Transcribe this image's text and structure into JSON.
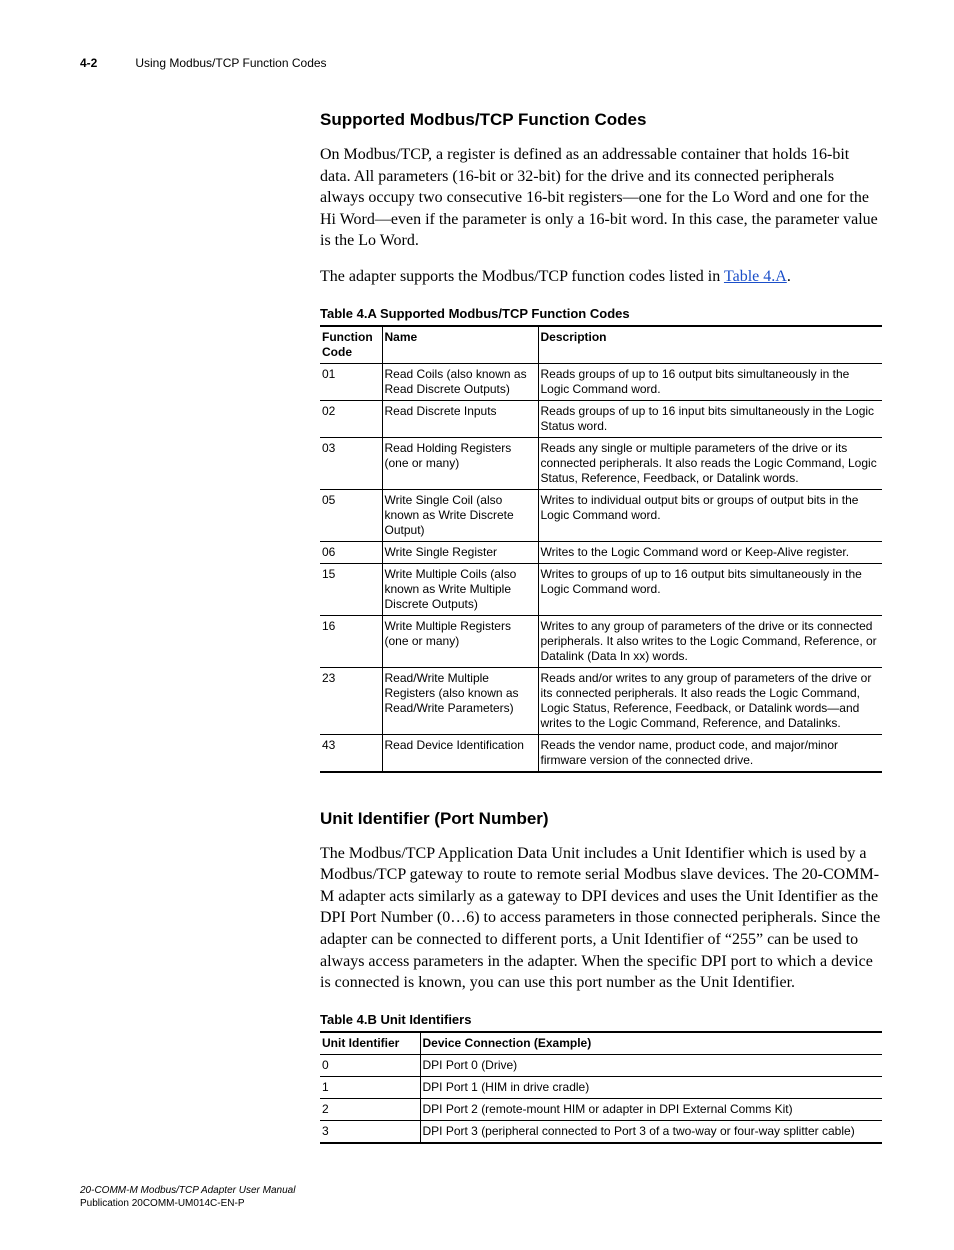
{
  "header": {
    "pageno": "4-2",
    "chapter": "Using Modbus/TCP Function Codes"
  },
  "section1": {
    "heading": "Supported Modbus/TCP Function Codes",
    "p1": "On Modbus/TCP, a register is defined as an addressable container that holds 16-bit data. All parameters (16-bit or 32-bit) for the drive and its connected peripherals always occupy two consecutive 16-bit registers—one for the Lo Word and one for the Hi Word—even if the parameter is only a 16-bit word. In this case, the parameter value is the Lo Word.",
    "p2a": "The adapter supports the Modbus/TCP function codes listed in ",
    "p2link": "Table 4.A",
    "p2b": "."
  },
  "tableA": {
    "caption": "Table 4.A   Supported Modbus/TCP Function Codes",
    "headers": {
      "c0": "Function Code",
      "c1": "Name",
      "c2": "Description"
    },
    "rows": [
      {
        "c0": "01",
        "c1": "Read Coils (also known as Read Discrete Outputs)",
        "c2": "Reads groups of up to 16 output bits simultaneously in the Logic Command word."
      },
      {
        "c0": "02",
        "c1": "Read Discrete Inputs",
        "c2": "Reads groups of up to 16 input bits simultaneously in the Logic Status word."
      },
      {
        "c0": "03",
        "c1": "Read Holding Registers (one or many)",
        "c2": "Reads any single or multiple parameters of the drive or its connected peripherals. It also reads the Logic Command, Logic Status, Reference, Feedback, or Datalink words."
      },
      {
        "c0": "05",
        "c1": "Write Single Coil (also known as Write Discrete Output)",
        "c2": "Writes to individual output bits or groups of output bits in the Logic Command word."
      },
      {
        "c0": "06",
        "c1": "Write Single Register",
        "c2": "Writes to the Logic Command word or Keep-Alive register."
      },
      {
        "c0": "15",
        "c1": "Write Multiple Coils (also known as Write Multiple Discrete Outputs)",
        "c2": "Writes to groups of up to 16 output bits simultaneously in the Logic Command word."
      },
      {
        "c0": "16",
        "c1": "Write Multiple Registers (one or many)",
        "c2": "Writes to any group of parameters of the drive or its connected peripherals. It also writes to the Logic Command, Reference, or Datalink (Data In xx) words."
      },
      {
        "c0": "23",
        "c1": "Read/Write Multiple Registers (also known as Read/Write Parameters)",
        "c2": "Reads and/or writes to any group of parameters of the drive or its connected peripherals. It also reads the Logic Command, Logic Status, Reference, Feedback, or Datalink words—and writes to the Logic Command, Reference, and Datalinks."
      },
      {
        "c0": "43",
        "c1": "Read Device Identification",
        "c2": "Reads the vendor name, product code, and major/minor firmware version of the connected drive."
      }
    ]
  },
  "section2": {
    "heading": "Unit Identifier (Port Number)",
    "p1": "The Modbus/TCP Application Data Unit includes a Unit Identifier which is used by a Modbus/TCP gateway to route to remote serial Modbus slave devices. The 20-COMM-M adapter acts similarly as a gateway to DPI devices and uses the Unit Identifier as the DPI Port Number (0…6) to access parameters in those connected peripherals. Since the adapter can be connected to different ports, a Unit Identifier of “255” can be used to always access parameters in the adapter. When the specific DPI port to which a device is connected is known, you can use this port number as the Unit Identifier."
  },
  "tableB": {
    "caption": "Table 4.B   Unit Identifiers",
    "headers": {
      "c0": "Unit Identifier",
      "c1": "Device Connection (Example)"
    },
    "rows": [
      {
        "c0": "0",
        "c1": "DPI Port 0 (Drive)"
      },
      {
        "c0": "1",
        "c1": "DPI Port 1 (HIM in drive cradle)"
      },
      {
        "c0": "2",
        "c1": "DPI Port 2 (remote-mount HIM or adapter in DPI External Comms Kit)"
      },
      {
        "c0": "3",
        "c1": "DPI Port 3 (peripheral connected to Port 3 of a two-way or four-way splitter cable)"
      }
    ]
  },
  "footer": {
    "line1": "20-COMM-M Modbus/TCP Adapter User Manual",
    "line2": "Publication 20COMM-UM014C-EN-P"
  }
}
